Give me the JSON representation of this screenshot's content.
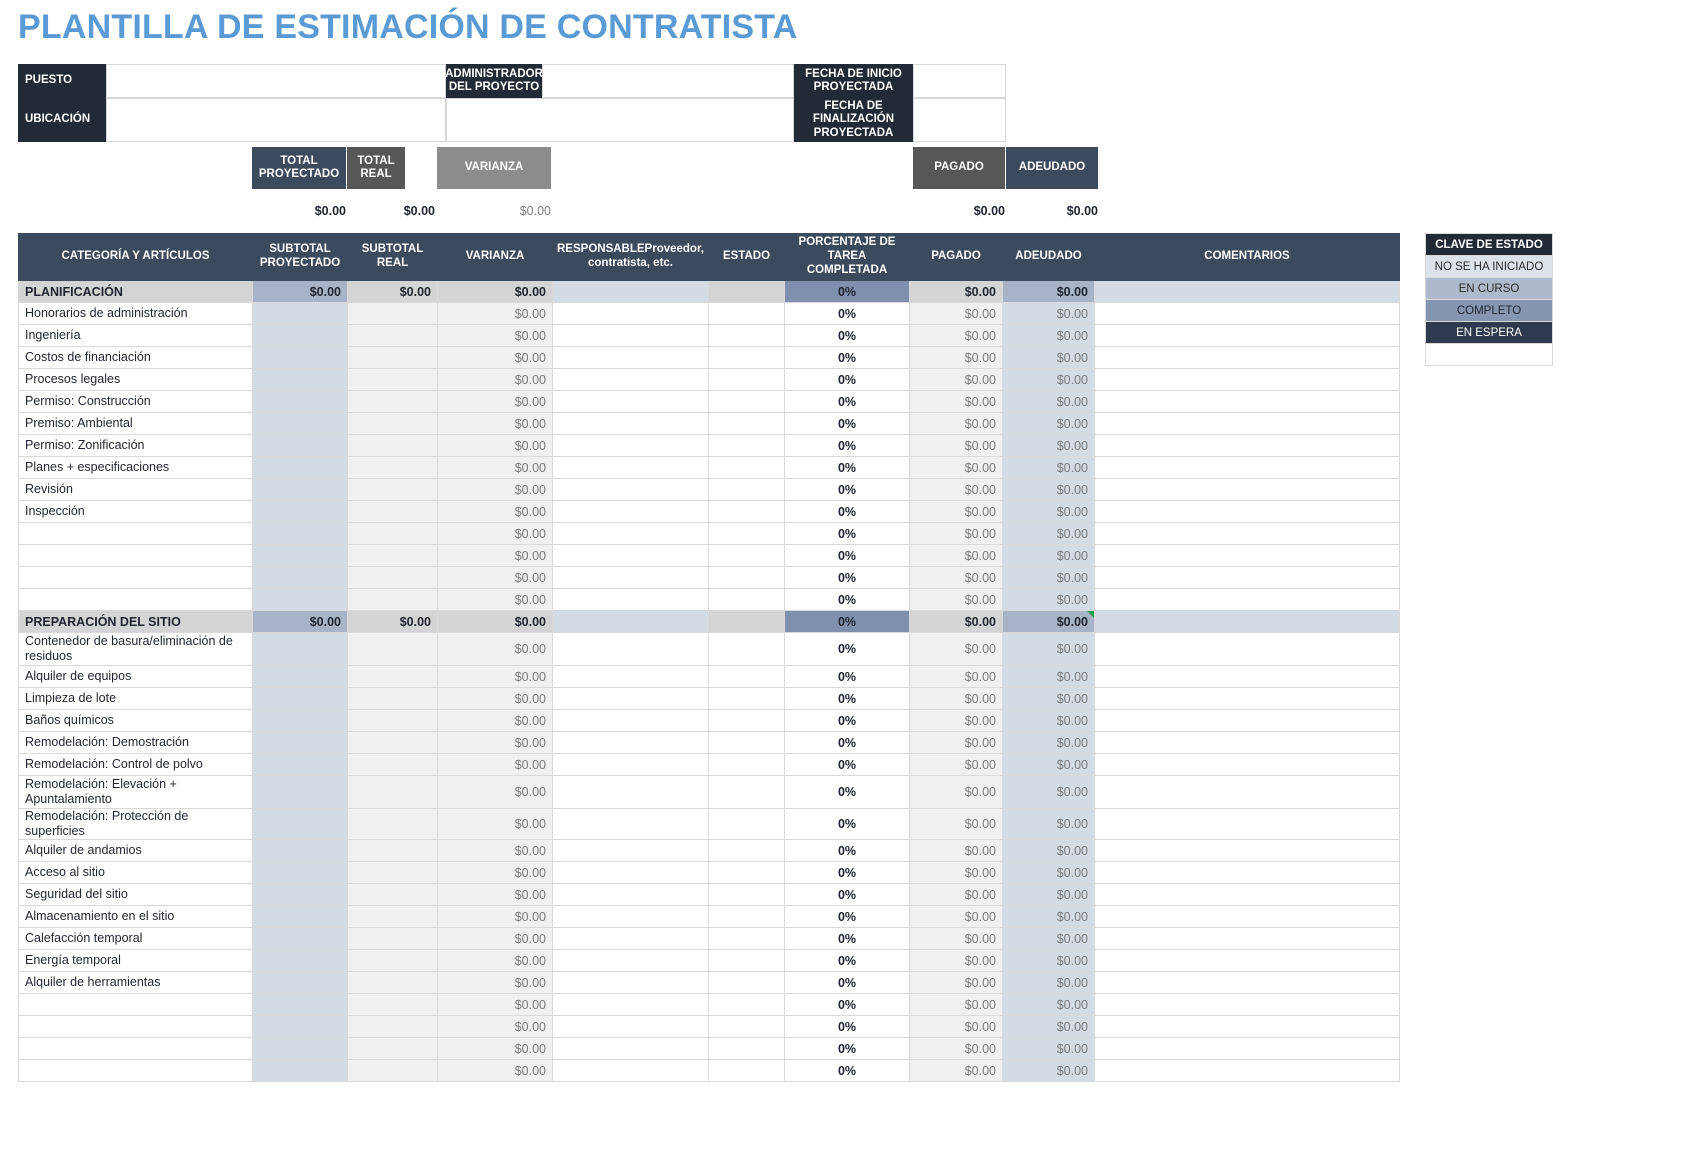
{
  "document": {
    "title": "PLANTILLA DE ESTIMACIÓN DE CONTRATISTA"
  },
  "info_panel": {
    "puesto_label": "PUESTO",
    "puesto_value": "",
    "ubicacion_label": "UBICACIÓN",
    "ubicacion_value": "",
    "admin_label": "ADMINISTRADOR DEL PROYECTO",
    "admin_value": "",
    "fecha_inicio_label": "FECHA DE INICIO PROYECTADA",
    "fecha_inicio_value": "",
    "fecha_fin_label": "FECHA DE FINALIZACIÓN PROYECTADA",
    "fecha_fin_value": ""
  },
  "summary": {
    "total_proyectado_label": "TOTAL PROYECTADO",
    "total_proyectado_value": "$0.00",
    "total_real_label": "TOTAL REAL",
    "total_real_value": "$0.00",
    "varianza_label": "VARIANZA",
    "varianza_value": "$0.00",
    "pagado_label": "PAGADO",
    "pagado_value": "$0.00",
    "adeudado_label": "ADEUDADO",
    "adeudado_value": "$0.00"
  },
  "table": {
    "headers": {
      "categoria": "CATEGORÍA Y ARTÍCULOS",
      "subtotal_proyectado": "SUBTOTAL PROYECTADO",
      "subtotal_real": "SUBTOTAL REAL",
      "varianza": "VARIANZA",
      "responsable": "RESPONSABLE",
      "responsable_sub": "Proveedor, contratista, etc.",
      "estado": "ESTADO",
      "porcentaje": "PORCENTAJE DE TAREA COMPLETADA",
      "pagado": "PAGADO",
      "adeudado": "ADEUDADO",
      "comentarios": "COMENTARIOS"
    },
    "sections": [
      {
        "name": "PLANIFICACIÓN",
        "subtotal_proyectado": "$0.00",
        "subtotal_real": "$0.00",
        "varianza": "$0.00",
        "responsable": "",
        "estado": "",
        "porcentaje": "0%",
        "pagado": "$0.00",
        "adeudado": "$0.00",
        "comentarios": "",
        "has_comment_marker": false,
        "rows": [
          {
            "name": "Honorarios de administración",
            "proyectado": "",
            "real": "",
            "varianza": "$0.00",
            "responsable": "",
            "estado": "",
            "porcentaje": "0%",
            "pagado": "$0.00",
            "adeudado": "$0.00",
            "comentarios": "",
            "tall": false
          },
          {
            "name": "Ingeniería",
            "proyectado": "",
            "real": "",
            "varianza": "$0.00",
            "responsable": "",
            "estado": "",
            "porcentaje": "0%",
            "pagado": "$0.00",
            "adeudado": "$0.00",
            "comentarios": "",
            "tall": false
          },
          {
            "name": "Costos de financiación",
            "proyectado": "",
            "real": "",
            "varianza": "$0.00",
            "responsable": "",
            "estado": "",
            "porcentaje": "0%",
            "pagado": "$0.00",
            "adeudado": "$0.00",
            "comentarios": "",
            "tall": false
          },
          {
            "name": "Procesos legales",
            "proyectado": "",
            "real": "",
            "varianza": "$0.00",
            "responsable": "",
            "estado": "",
            "porcentaje": "0%",
            "pagado": "$0.00",
            "adeudado": "$0.00",
            "comentarios": "",
            "tall": false
          },
          {
            "name": "Permiso: Construcción",
            "proyectado": "",
            "real": "",
            "varianza": "$0.00",
            "responsable": "",
            "estado": "",
            "porcentaje": "0%",
            "pagado": "$0.00",
            "adeudado": "$0.00",
            "comentarios": "",
            "tall": false
          },
          {
            "name": "Premiso: Ambiental",
            "proyectado": "",
            "real": "",
            "varianza": "$0.00",
            "responsable": "",
            "estado": "",
            "porcentaje": "0%",
            "pagado": "$0.00",
            "adeudado": "$0.00",
            "comentarios": "",
            "tall": false
          },
          {
            "name": "Permiso: Zonificación",
            "proyectado": "",
            "real": "",
            "varianza": "$0.00",
            "responsable": "",
            "estado": "",
            "porcentaje": "0%",
            "pagado": "$0.00",
            "adeudado": "$0.00",
            "comentarios": "",
            "tall": false
          },
          {
            "name": "Planes + especificaciones",
            "proyectado": "",
            "real": "",
            "varianza": "$0.00",
            "responsable": "",
            "estado": "",
            "porcentaje": "0%",
            "pagado": "$0.00",
            "adeudado": "$0.00",
            "comentarios": "",
            "tall": false
          },
          {
            "name": "Revisión",
            "proyectado": "",
            "real": "",
            "varianza": "$0.00",
            "responsable": "",
            "estado": "",
            "porcentaje": "0%",
            "pagado": "$0.00",
            "adeudado": "$0.00",
            "comentarios": "",
            "tall": false
          },
          {
            "name": "Inspección",
            "proyectado": "",
            "real": "",
            "varianza": "$0.00",
            "responsable": "",
            "estado": "",
            "porcentaje": "0%",
            "pagado": "$0.00",
            "adeudado": "$0.00",
            "comentarios": "",
            "tall": false
          },
          {
            "name": "",
            "proyectado": "",
            "real": "",
            "varianza": "$0.00",
            "responsable": "",
            "estado": "",
            "porcentaje": "0%",
            "pagado": "$0.00",
            "adeudado": "$0.00",
            "comentarios": "",
            "tall": false
          },
          {
            "name": "",
            "proyectado": "",
            "real": "",
            "varianza": "$0.00",
            "responsable": "",
            "estado": "",
            "porcentaje": "0%",
            "pagado": "$0.00",
            "adeudado": "$0.00",
            "comentarios": "",
            "tall": false
          },
          {
            "name": "",
            "proyectado": "",
            "real": "",
            "varianza": "$0.00",
            "responsable": "",
            "estado": "",
            "porcentaje": "0%",
            "pagado": "$0.00",
            "adeudado": "$0.00",
            "comentarios": "",
            "tall": false
          },
          {
            "name": "",
            "proyectado": "",
            "real": "",
            "varianza": "$0.00",
            "responsable": "",
            "estado": "",
            "porcentaje": "0%",
            "pagado": "$0.00",
            "adeudado": "$0.00",
            "comentarios": "",
            "tall": false
          }
        ]
      },
      {
        "name": "PREPARACIÓN DEL SITIO",
        "subtotal_proyectado": "$0.00",
        "subtotal_real": "$0.00",
        "varianza": "$0.00",
        "responsable": "",
        "estado": "",
        "porcentaje": "0%",
        "pagado": "$0.00",
        "adeudado": "$0.00",
        "comentarios": "",
        "has_comment_marker": true,
        "rows": [
          {
            "name": "Contenedor de basura/eliminación de residuos",
            "proyectado": "",
            "real": "",
            "varianza": "$0.00",
            "responsable": "",
            "estado": "",
            "porcentaje": "0%",
            "pagado": "$0.00",
            "adeudado": "$0.00",
            "comentarios": "",
            "tall": true
          },
          {
            "name": "Alquiler de equipos",
            "proyectado": "",
            "real": "",
            "varianza": "$0.00",
            "responsable": "",
            "estado": "",
            "porcentaje": "0%",
            "pagado": "$0.00",
            "adeudado": "$0.00",
            "comentarios": "",
            "tall": false
          },
          {
            "name": "Limpieza de lote",
            "proyectado": "",
            "real": "",
            "varianza": "$0.00",
            "responsable": "",
            "estado": "",
            "porcentaje": "0%",
            "pagado": "$0.00",
            "adeudado": "$0.00",
            "comentarios": "",
            "tall": false
          },
          {
            "name": "Baños químicos",
            "proyectado": "",
            "real": "",
            "varianza": "$0.00",
            "responsable": "",
            "estado": "",
            "porcentaje": "0%",
            "pagado": "$0.00",
            "adeudado": "$0.00",
            "comentarios": "",
            "tall": false
          },
          {
            "name": "Remodelación: Demostración",
            "proyectado": "",
            "real": "",
            "varianza": "$0.00",
            "responsable": "",
            "estado": "",
            "porcentaje": "0%",
            "pagado": "$0.00",
            "adeudado": "$0.00",
            "comentarios": "",
            "tall": false
          },
          {
            "name": "Remodelación: Control de polvo",
            "proyectado": "",
            "real": "",
            "varianza": "$0.00",
            "responsable": "",
            "estado": "",
            "porcentaje": "0%",
            "pagado": "$0.00",
            "adeudado": "$0.00",
            "comentarios": "",
            "tall": false
          },
          {
            "name": "Remodelación: Elevación + Apuntalamiento",
            "proyectado": "",
            "real": "",
            "varianza": "$0.00",
            "responsable": "",
            "estado": "",
            "porcentaje": "0%",
            "pagado": "$0.00",
            "adeudado": "$0.00",
            "comentarios": "",
            "tall": true
          },
          {
            "name": "Remodelación: Protección de superficies",
            "proyectado": "",
            "real": "",
            "varianza": "$0.00",
            "responsable": "",
            "estado": "",
            "porcentaje": "0%",
            "pagado": "$0.00",
            "adeudado": "$0.00",
            "comentarios": "",
            "tall": false
          },
          {
            "name": "Alquiler de andamios",
            "proyectado": "",
            "real": "",
            "varianza": "$0.00",
            "responsable": "",
            "estado": "",
            "porcentaje": "0%",
            "pagado": "$0.00",
            "adeudado": "$0.00",
            "comentarios": "",
            "tall": false
          },
          {
            "name": "Acceso al sitio",
            "proyectado": "",
            "real": "",
            "varianza": "$0.00",
            "responsable": "",
            "estado": "",
            "porcentaje": "0%",
            "pagado": "$0.00",
            "adeudado": "$0.00",
            "comentarios": "",
            "tall": false
          },
          {
            "name": "Seguridad del sitio",
            "proyectado": "",
            "real": "",
            "varianza": "$0.00",
            "responsable": "",
            "estado": "",
            "porcentaje": "0%",
            "pagado": "$0.00",
            "adeudado": "$0.00",
            "comentarios": "",
            "tall": false
          },
          {
            "name": "Almacenamiento en el sitio",
            "proyectado": "",
            "real": "",
            "varianza": "$0.00",
            "responsable": "",
            "estado": "",
            "porcentaje": "0%",
            "pagado": "$0.00",
            "adeudado": "$0.00",
            "comentarios": "",
            "tall": false
          },
          {
            "name": "Calefacción temporal",
            "proyectado": "",
            "real": "",
            "varianza": "$0.00",
            "responsable": "",
            "estado": "",
            "porcentaje": "0%",
            "pagado": "$0.00",
            "adeudado": "$0.00",
            "comentarios": "",
            "tall": false
          },
          {
            "name": "Energía temporal",
            "proyectado": "",
            "real": "",
            "varianza": "$0.00",
            "responsable": "",
            "estado": "",
            "porcentaje": "0%",
            "pagado": "$0.00",
            "adeudado": "$0.00",
            "comentarios": "",
            "tall": false
          },
          {
            "name": "Alquiler de herramientas",
            "proyectado": "",
            "real": "",
            "varianza": "$0.00",
            "responsable": "",
            "estado": "",
            "porcentaje": "0%",
            "pagado": "$0.00",
            "adeudado": "$0.00",
            "comentarios": "",
            "tall": false
          },
          {
            "name": "",
            "proyectado": "",
            "real": "",
            "varianza": "$0.00",
            "responsable": "",
            "estado": "",
            "porcentaje": "0%",
            "pagado": "$0.00",
            "adeudado": "$0.00",
            "comentarios": "",
            "tall": false
          },
          {
            "name": "",
            "proyectado": "",
            "real": "",
            "varianza": "$0.00",
            "responsable": "",
            "estado": "",
            "porcentaje": "0%",
            "pagado": "$0.00",
            "adeudado": "$0.00",
            "comentarios": "",
            "tall": false
          },
          {
            "name": "",
            "proyectado": "",
            "real": "",
            "varianza": "$0.00",
            "responsable": "",
            "estado": "",
            "porcentaje": "0%",
            "pagado": "$0.00",
            "adeudado": "$0.00",
            "comentarios": "",
            "tall": false
          },
          {
            "name": "",
            "proyectado": "",
            "real": "",
            "varianza": "$0.00",
            "responsable": "",
            "estado": "",
            "porcentaje": "0%",
            "pagado": "$0.00",
            "adeudado": "$0.00",
            "comentarios": "",
            "tall": false
          }
        ]
      }
    ]
  },
  "status_key": {
    "title": "CLAVE DE ESTADO",
    "items": [
      {
        "label": "NO SE HA INICIADO",
        "style": "k-notstarted"
      },
      {
        "label": "EN CURSO",
        "style": "k-progress"
      },
      {
        "label": "COMPLETO",
        "style": "k-complete"
      },
      {
        "label": "EN ESPERA",
        "style": "k-hold"
      },
      {
        "label": "",
        "style": "k-blank"
      }
    ]
  },
  "colors": {
    "title": "#5B9BD5",
    "header_navy": "#3C4A5E",
    "header_dark": "#222A35",
    "gray_dark": "#575757",
    "gray_mid": "#8C8C8C",
    "cat_row": "#D4D4D4",
    "proj_col": "#D3DBE5",
    "cat_proj": "#A7B4C8",
    "cat_pct": "#7E90AD",
    "comment_marker": "#1E9E4A"
  }
}
